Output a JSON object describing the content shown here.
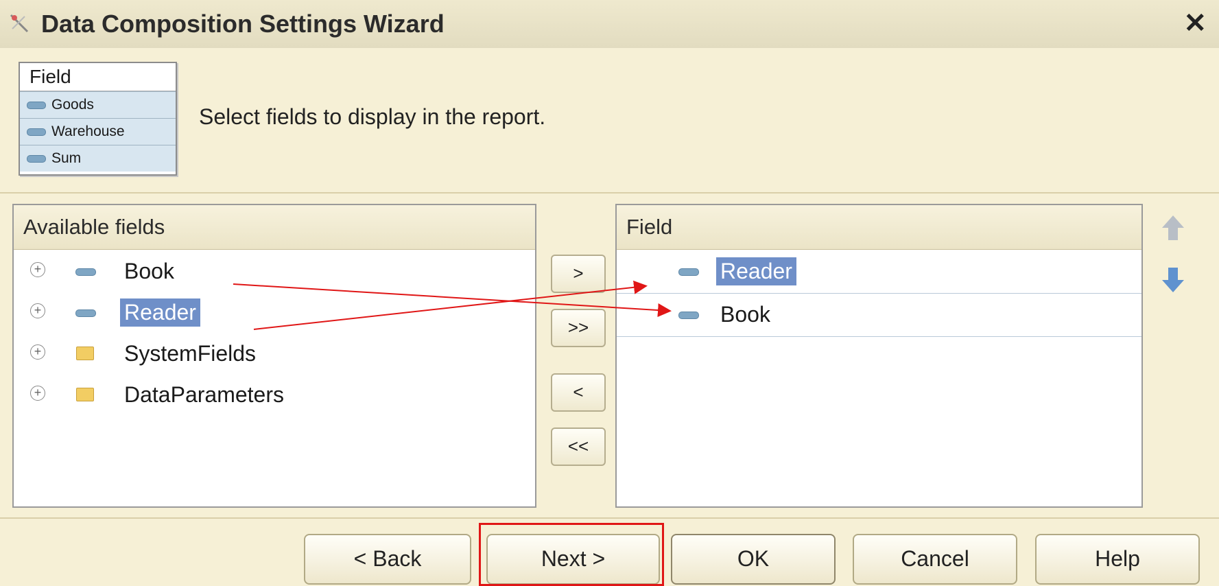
{
  "window": {
    "title": "Data Composition Settings Wizard",
    "close_icon": "close-icon"
  },
  "preview": {
    "header": "Field",
    "rows": [
      "Goods",
      "Warehouse",
      "Sum"
    ]
  },
  "instruction": "Select fields to display in the report.",
  "available_fields": {
    "header": "Available fields",
    "items": [
      {
        "label": "Book",
        "icon": "field-icon",
        "selected": false
      },
      {
        "label": "Reader",
        "icon": "field-icon",
        "selected": true
      },
      {
        "label": "SystemFields",
        "icon": "folder-icon",
        "selected": false
      },
      {
        "label": "DataParameters",
        "icon": "folder-icon",
        "selected": false
      }
    ]
  },
  "move_buttons": {
    "add": ">",
    "add_all": ">>",
    "remove": "<",
    "remove_all": "<<"
  },
  "selected_fields": {
    "header": "Field",
    "items": [
      {
        "label": "Reader",
        "selected": true
      },
      {
        "label": "Book",
        "selected": false
      }
    ]
  },
  "buttons": {
    "back": "< Back",
    "next": "Next >",
    "ok": "OK",
    "cancel": "Cancel",
    "help": "Help"
  },
  "colors": {
    "background": "#f6f0d6",
    "selection": "#6f8fc8",
    "annotation_red": "#e01616"
  }
}
